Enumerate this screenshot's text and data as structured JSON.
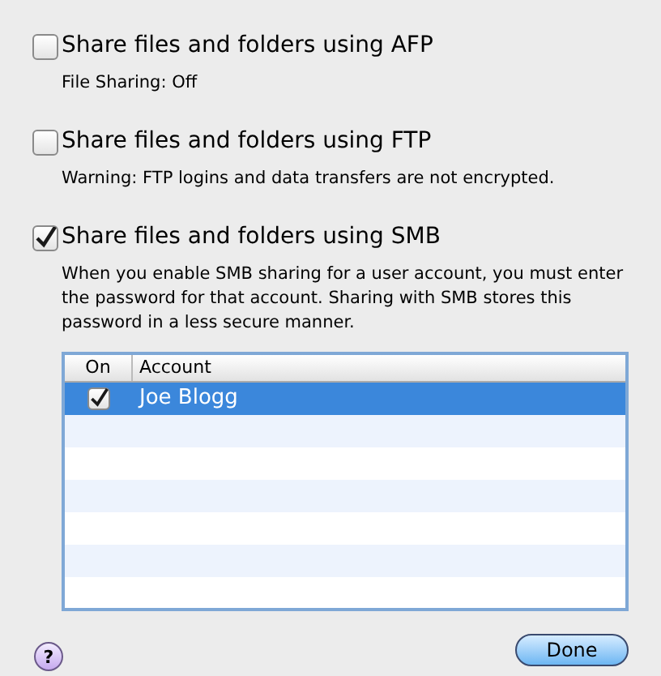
{
  "services": [
    {
      "label": "Share files and folders using AFP",
      "checked": false,
      "note": "File Sharing: Off"
    },
    {
      "label": "Share files and folders using FTP",
      "checked": false,
      "note": "Warning: FTP logins and data transfers are not encrypted."
    },
    {
      "label": "Share files and folders using SMB",
      "checked": true,
      "note": "When you enable SMB sharing for a user account, you must enter the password for that account. Sharing with SMB stores this password in a less secure manner."
    }
  ],
  "table": {
    "columns": [
      "On",
      "Account"
    ],
    "rows": [
      {
        "on": true,
        "account": "Joe Blogg",
        "selected": true
      }
    ]
  },
  "help_button": "?",
  "done_button": "Done"
}
